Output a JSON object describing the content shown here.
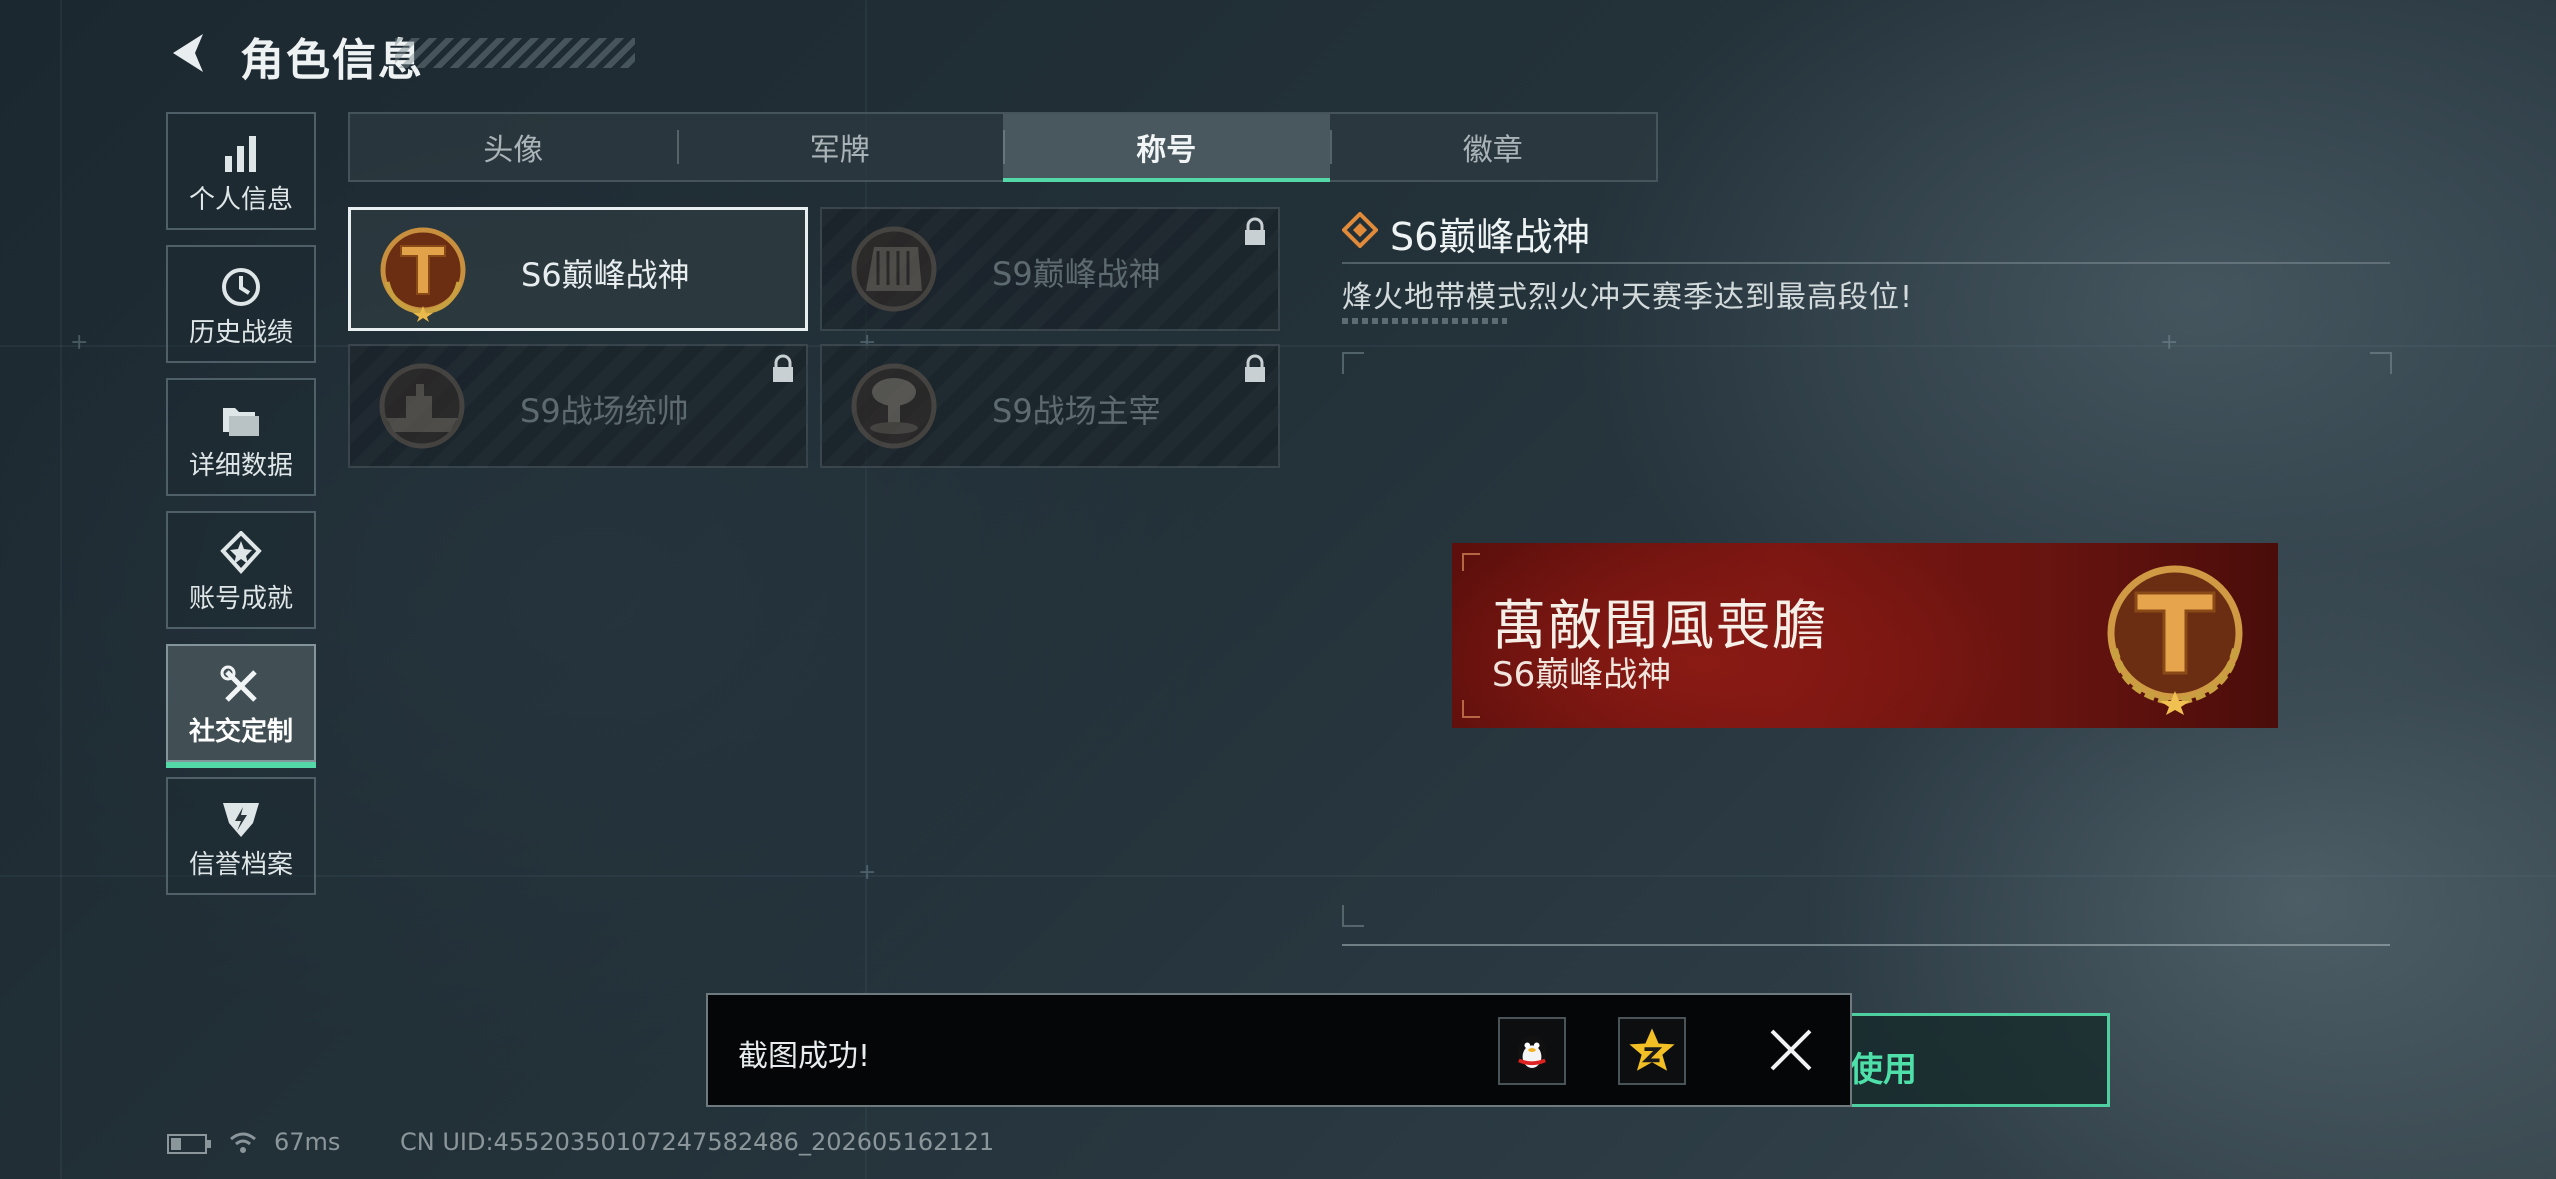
{
  "header": {
    "title": "角色信息"
  },
  "sidebar": {
    "items": [
      {
        "label": "个人信息",
        "icon": "bar-chart-icon"
      },
      {
        "label": "历史战绩",
        "icon": "history-clock-icon"
      },
      {
        "label": "详细数据",
        "icon": "folder-data-icon"
      },
      {
        "label": "账号成就",
        "icon": "achievement-icon"
      },
      {
        "label": "社交定制",
        "icon": "tools-icon",
        "active": true
      },
      {
        "label": "信誉档案",
        "icon": "reputation-icon"
      }
    ]
  },
  "tabs": [
    {
      "label": "头像"
    },
    {
      "label": "军牌"
    },
    {
      "label": "称号",
      "active": true
    },
    {
      "label": "徽章"
    }
  ],
  "titles": [
    {
      "name": "S6巅峰战神",
      "selected": true,
      "locked": false,
      "icon": "laurel-t-emblem-icon"
    },
    {
      "name": "S9巅峰战神",
      "selected": false,
      "locked": true,
      "icon": "fortress-emblem-icon"
    },
    {
      "name": "S9战场统帅",
      "selected": false,
      "locked": true,
      "icon": "battleship-emblem-icon"
    },
    {
      "name": "S9战场主宰",
      "selected": false,
      "locked": true,
      "icon": "explosion-emblem-icon"
    }
  ],
  "detail": {
    "title": "S6巅峰战神",
    "description": "烽火地带模式烈火冲天赛季达到最高段位!"
  },
  "banner": {
    "title": "萬敵聞風喪膽",
    "subtitle": "S6巅峰战神",
    "bg_color": "#7a1612"
  },
  "use_button": {
    "label": "使用"
  },
  "toast": {
    "message": "截图成功!",
    "share_icons": [
      "qq-penguin-icon",
      "qzone-star-icon"
    ]
  },
  "status_bar": {
    "ping": "67ms",
    "uid": "CN UID:4552035010724758248​6_202605162121"
  },
  "colors": {
    "accent": "#54d8a8",
    "banner": "#7a1612"
  }
}
